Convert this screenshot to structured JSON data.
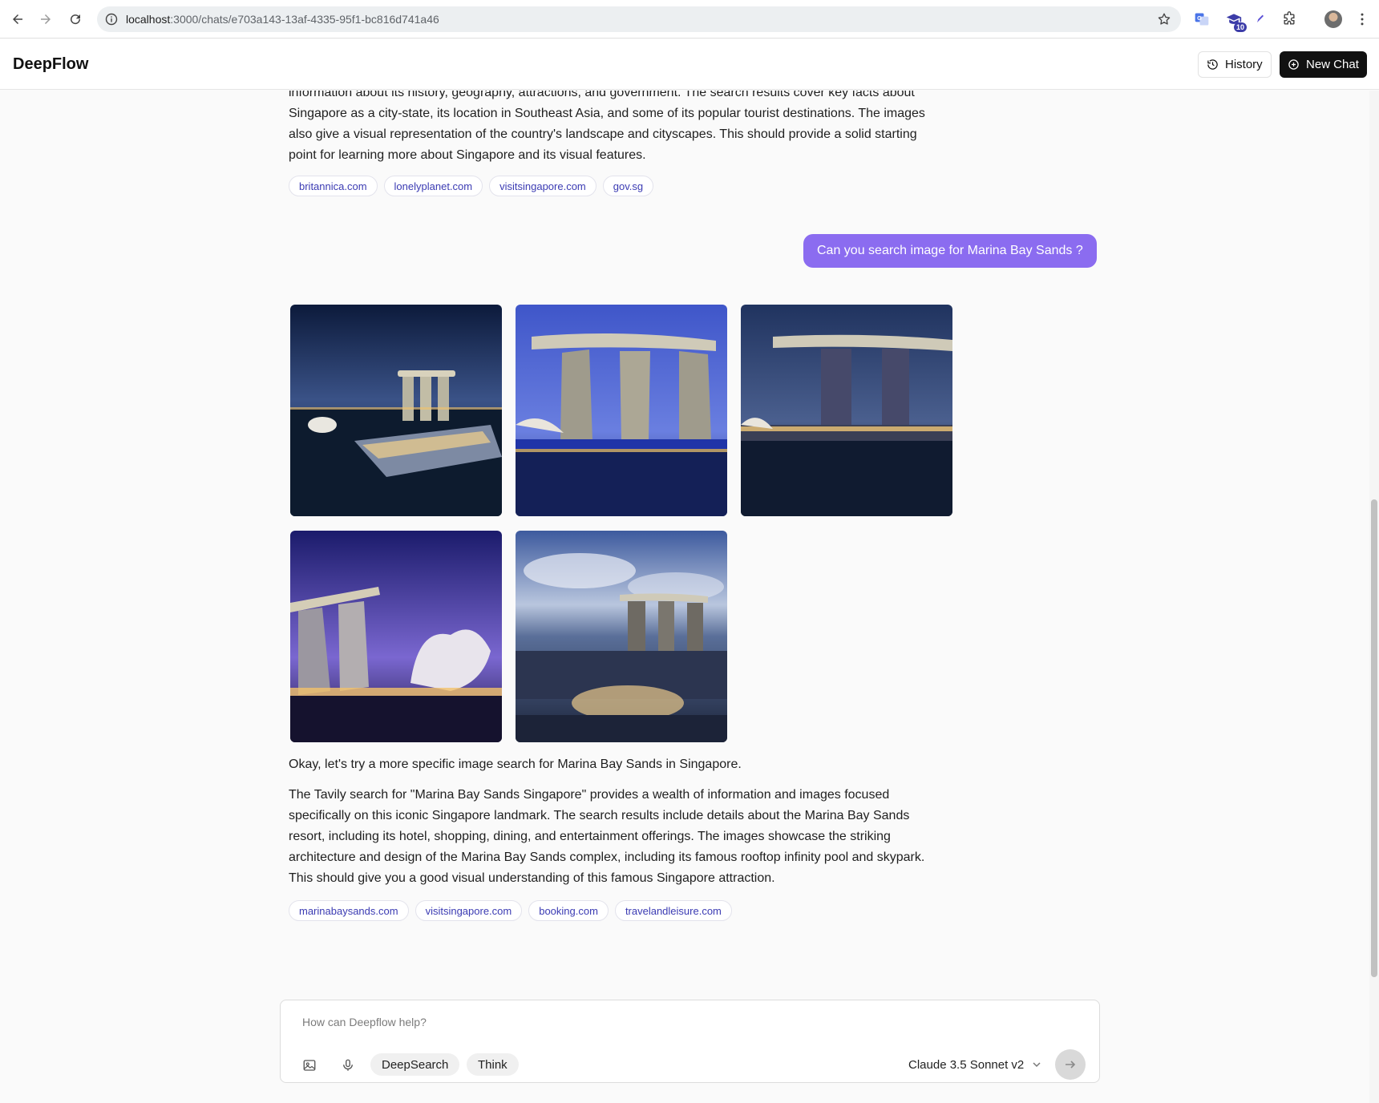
{
  "browser": {
    "url_host": "localhost",
    "url_path": ":3000/chats/e703a143-13af-4335-95f1-bc816d741a46",
    "extension_badge": "10"
  },
  "header": {
    "brand": "DeepFlow",
    "history_label": "History",
    "new_chat_label": "New Chat"
  },
  "messages": {
    "first_answer": {
      "lines": [
        "information about its history, geography, attractions, and government. The search results cover key facts about",
        "Singapore as a city-state, its location in Southeast Asia, and some of its popular tourist destinations. The images",
        "also give a visual representation of the country's landscape and cityscapes. This should provide a solid starting",
        "point for learning more about Singapore and its visual features."
      ],
      "sources": [
        "britannica.com",
        "lonelyplanet.com",
        "visitsingapore.com",
        "gov.sg"
      ]
    },
    "user_question": "Can you search image for Marina Bay Sands ?",
    "second_answer": {
      "intro": "Okay, let's try a more specific image search for Marina Bay Sands in Singapore.",
      "summary": "The Tavily search for \"Marina Bay Sands Singapore\" provides a wealth of information and images focused specifically on this iconic Singapore landmark. The search results include details about the Marina Bay Sands resort, including its hotel, shopping, dining, and entertainment offerings. The images showcase the striking architecture and design of the Marina Bay Sands complex, including its famous rooftop infinity pool and skypark. This should give you a good visual understanding of this famous Singapore attraction.",
      "sources": [
        "marinabaysands.com",
        "visitsingapore.com",
        "booking.com",
        "travelandleisure.com"
      ],
      "images": [
        {
          "name": "Marina Bay Sands night aerial"
        },
        {
          "name": "Marina Bay Sands blue hour"
        },
        {
          "name": "Marina Bay Sands towers dusk"
        },
        {
          "name": "Marina Bay Sands ArtScience Museum"
        },
        {
          "name": "Marina Bay Sands bay view"
        }
      ]
    }
  },
  "composer": {
    "placeholder": "How can Deepflow help?",
    "deepsearch_label": "DeepSearch",
    "think_label": "Think",
    "model": "Claude 3.5 Sonnet v2"
  },
  "colors": {
    "accent": "#8b6cf0",
    "chip_text": "#3b3bb3",
    "dark_button": "#111111"
  }
}
